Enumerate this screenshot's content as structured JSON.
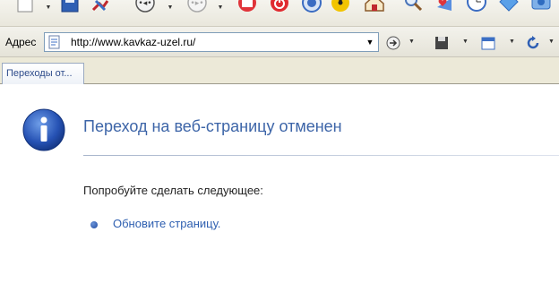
{
  "toolbar": {
    "icons": [
      "new-page-icon",
      "save-icon",
      "tools-icon",
      "back-icon",
      "forward-icon",
      "home-red-icon",
      "power-icon",
      "browser-icon",
      "radiation-icon",
      "home-icon",
      "search-icon",
      "favorites-icon",
      "clock-icon",
      "diamond-icon",
      "gallery-icon"
    ]
  },
  "address_bar": {
    "label": "Адрес",
    "url": "http://www.kavkaz-uzel.ru/"
  },
  "tabs": [
    {
      "label": "Переходы от..."
    }
  ],
  "error_page": {
    "title": "Переход на веб-страницу отменен",
    "try_text": "Попробуйте сделать следующее:",
    "refresh_link": "Обновите страницу."
  },
  "colors": {
    "title": "#3d65a8",
    "link": "#2e5fb0",
    "divider": "#a9b6cc"
  }
}
